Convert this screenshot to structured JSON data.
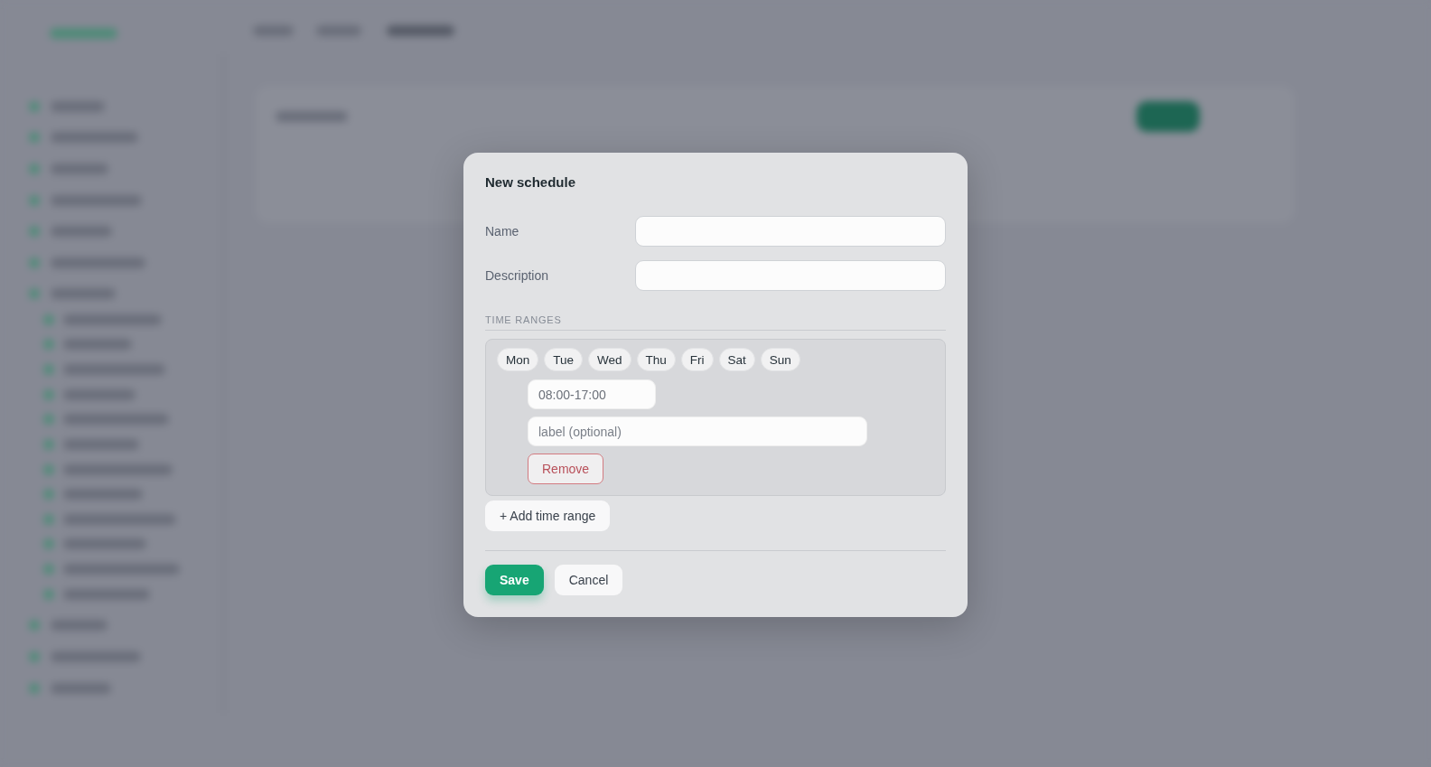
{
  "dialog": {
    "title": "New schedule",
    "fields": [
      {
        "label": "Name"
      },
      {
        "label": "Description"
      }
    ],
    "section_title": "TIME RANGES",
    "time_ranges": [
      {
        "days": [
          {
            "label": "Mon",
            "selected": false
          },
          {
            "label": "Tue",
            "selected": false
          },
          {
            "label": "Wed",
            "selected": false
          },
          {
            "label": "Thu",
            "selected": false
          },
          {
            "label": "Fri",
            "selected": false
          },
          {
            "label": "Sat",
            "selected": false
          },
          {
            "label": "Sun",
            "selected": false
          }
        ],
        "time": "08:00-17:00",
        "label_placeholder": "label (optional)",
        "remove_button": "Remove"
      }
    ],
    "add_button": "+ Add time range",
    "buttons": [
      {
        "label": "Save",
        "kind": "primary"
      },
      {
        "label": "Cancel",
        "kind": "secondary"
      }
    ]
  }
}
